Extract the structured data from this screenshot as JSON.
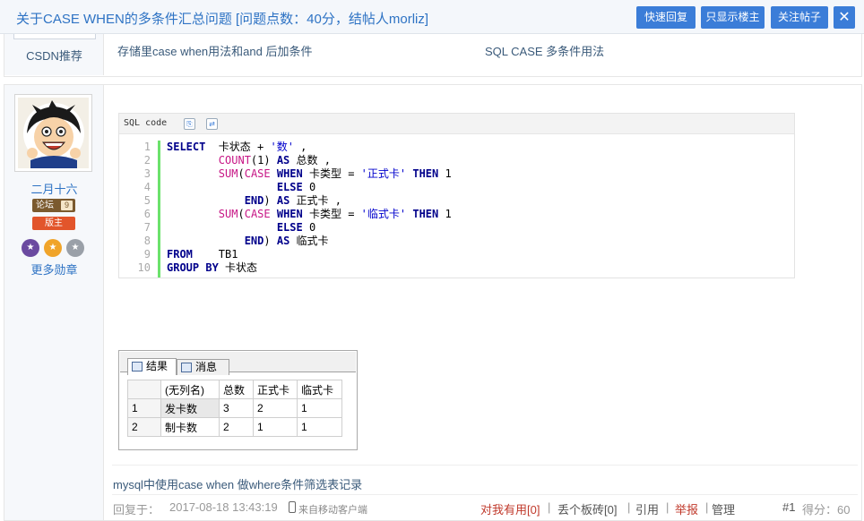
{
  "header": {
    "title": "关于CASE WHEN的多条件汇总问题 [问题点数：40分，结帖人morliz]",
    "buttons": {
      "quick_reply": "快速回复",
      "only_op": "只显示楼主",
      "follow": "关注帖子",
      "close": "✕"
    }
  },
  "recommend": {
    "label": "CSDN推荐",
    "links": [
      "存储里case when用法和and 后加条件",
      "SQL CASE 多条件用法"
    ]
  },
  "user": {
    "name": "二月十六",
    "forum_badge": "论坛",
    "forum_level": "9",
    "moderator_badge": "版主",
    "more_medals": "更多勋章"
  },
  "code": {
    "language": "SQL code",
    "line_numbers": [
      "1",
      "2",
      "3",
      "4",
      "5",
      "6",
      "7",
      "8",
      "9",
      "10"
    ],
    "lines": [
      [
        {
          "t": "SELECT",
          "c": "kw"
        },
        {
          "t": "  卡状态 + ",
          "c": ""
        },
        {
          "t": "'数'",
          "c": "st"
        },
        {
          "t": " ,",
          "c": ""
        }
      ],
      [
        {
          "t": "        ",
          "c": ""
        },
        {
          "t": "COUNT",
          "c": "fn"
        },
        {
          "t": "(1) ",
          "c": ""
        },
        {
          "t": "AS",
          "c": "kw"
        },
        {
          "t": " 总数 ,",
          "c": ""
        }
      ],
      [
        {
          "t": "        ",
          "c": ""
        },
        {
          "t": "SUM",
          "c": "fn"
        },
        {
          "t": "(",
          "c": ""
        },
        {
          "t": "CASE",
          "c": "fn"
        },
        {
          "t": " ",
          "c": ""
        },
        {
          "t": "WHEN",
          "c": "kw"
        },
        {
          "t": " 卡类型 = ",
          "c": ""
        },
        {
          "t": "'正式卡'",
          "c": "st"
        },
        {
          "t": " ",
          "c": ""
        },
        {
          "t": "THEN",
          "c": "kw"
        },
        {
          "t": " 1",
          "c": ""
        }
      ],
      [
        {
          "t": "                 ",
          "c": ""
        },
        {
          "t": "ELSE",
          "c": "kw"
        },
        {
          "t": " 0",
          "c": ""
        }
      ],
      [
        {
          "t": "            ",
          "c": ""
        },
        {
          "t": "END",
          "c": "kw"
        },
        {
          "t": ") ",
          "c": ""
        },
        {
          "t": "AS",
          "c": "kw"
        },
        {
          "t": " 正式卡 ,",
          "c": ""
        }
      ],
      [
        {
          "t": "        ",
          "c": ""
        },
        {
          "t": "SUM",
          "c": "fn"
        },
        {
          "t": "(",
          "c": ""
        },
        {
          "t": "CASE",
          "c": "fn"
        },
        {
          "t": " ",
          "c": ""
        },
        {
          "t": "WHEN",
          "c": "kw"
        },
        {
          "t": " 卡类型 = ",
          "c": ""
        },
        {
          "t": "'临式卡'",
          "c": "st"
        },
        {
          "t": " ",
          "c": ""
        },
        {
          "t": "THEN",
          "c": "kw"
        },
        {
          "t": " 1",
          "c": ""
        }
      ],
      [
        {
          "t": "                 ",
          "c": ""
        },
        {
          "t": "ELSE",
          "c": "kw"
        },
        {
          "t": " 0",
          "c": ""
        }
      ],
      [
        {
          "t": "            ",
          "c": ""
        },
        {
          "t": "END",
          "c": "kw"
        },
        {
          "t": ") ",
          "c": ""
        },
        {
          "t": "AS",
          "c": "kw"
        },
        {
          "t": " 临式卡",
          "c": ""
        }
      ],
      [
        {
          "t": "FROM",
          "c": "kw"
        },
        {
          "t": "    TB1",
          "c": ""
        }
      ],
      [
        {
          "t": "GROUP BY",
          "c": "kw"
        },
        {
          "t": " 卡状态",
          "c": ""
        }
      ]
    ]
  },
  "result": {
    "tabs": [
      "结果",
      "消息"
    ],
    "columns": [
      "",
      "(无列名)",
      "总数",
      "正式卡",
      "临式卡"
    ],
    "rows": [
      [
        "1",
        "发卡数",
        "3",
        "2",
        "1"
      ],
      [
        "2",
        "制卡数",
        "2",
        "1",
        "1"
      ]
    ]
  },
  "signature": "mysql中使用case when 做where条件筛选表记录",
  "footer": {
    "reply_label": "回复于：",
    "time": "2017-08-18 13:43:19",
    "client": "来自移动客户端",
    "useful": "对我有用[0]",
    "brick": "丢个板砖[0]",
    "quote": "引用",
    "report": "举报",
    "manage": "管理",
    "separator": "|",
    "floor": "#1",
    "score": "得分：60"
  },
  "colors": {
    "accent": "#3b7dd8",
    "link": "#2e73c4",
    "highlight": "#c0392b"
  }
}
